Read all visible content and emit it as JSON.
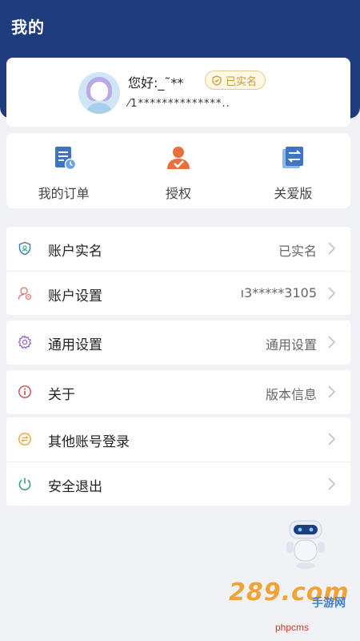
{
  "header": {
    "title": "我的"
  },
  "profile": {
    "greeting": "您好:_˜**",
    "verified_badge": "已实名",
    "masked_phone": "⁄1**************..",
    "avatar_icon": "user-avatar"
  },
  "quick_actions": [
    {
      "label": "我的订单",
      "icon": "order-list-icon"
    },
    {
      "label": "授权",
      "icon": "authorize-icon"
    },
    {
      "label": "关爱版",
      "icon": "care-version-icon"
    }
  ],
  "menu": {
    "group1": [
      {
        "label": "账户实名",
        "value": "已实名",
        "icon": "shield-id-icon"
      },
      {
        "label": "账户设置",
        "value": "ı3*****3105",
        "icon": "user-settings-icon"
      }
    ],
    "group2": [
      {
        "label": "通用设置",
        "value": "通用设置",
        "icon": "gear-icon"
      }
    ],
    "group3": [
      {
        "label": "关于",
        "value": "版本信息",
        "icon": "info-icon"
      }
    ],
    "group4": [
      {
        "label": "其他账号登录",
        "value": "",
        "icon": "switch-account-icon"
      },
      {
        "label": "安全退出",
        "value": "",
        "icon": "power-icon"
      }
    ]
  },
  "watermark": {
    "logo": "289.com",
    "sub": "手游网",
    "text": "phpcms"
  },
  "colors": {
    "header": "#1f3c7e",
    "accent_gold": "#c99b3c",
    "background": "#f1f2f5"
  }
}
